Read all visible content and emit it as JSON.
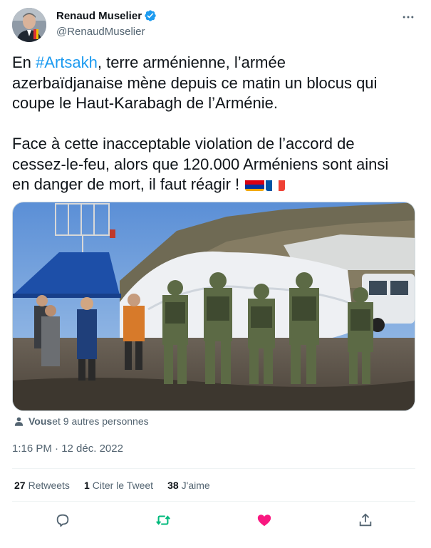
{
  "author": {
    "display_name": "Renaud Muselier",
    "handle": "@RenaudMuselier",
    "verified_icon": "verified-badge-icon",
    "avatar": "avatar"
  },
  "tweet": {
    "line1_pre": "En ",
    "hashtag": "#Artsakh",
    "line1_post": ", terre arménienne, l’armée",
    "line2": "azerbaïdjanaise mène depuis ce matin un blocus qui",
    "line3": "coupe le Haut-Karabagh de l’Arménie.",
    "line4": "Face à cette inacceptable violation de l’accord de",
    "line5": "cessez-le-feu, alors que 120.000 Arméniens sont ainsi",
    "line6": "en danger de mort, il faut réagir ! ",
    "flags": [
      "flag-armenia-icon",
      "flag-france-icon"
    ]
  },
  "likers": {
    "bold": "Vous",
    "rest": " et 9 autres personnes"
  },
  "timestamp": "1:16 PM · 12 déc. 2022",
  "stats": {
    "retweets_count": "27",
    "retweets_label": "Retweets",
    "quotes_count": "1",
    "quotes_label": "Citer le Tweet",
    "likes_count": "38",
    "likes_label": "J'aime"
  },
  "colors": {
    "link": "#1d9bf0",
    "retweet": "#00ba7c",
    "like": "#f91880",
    "secondary": "#536471"
  }
}
